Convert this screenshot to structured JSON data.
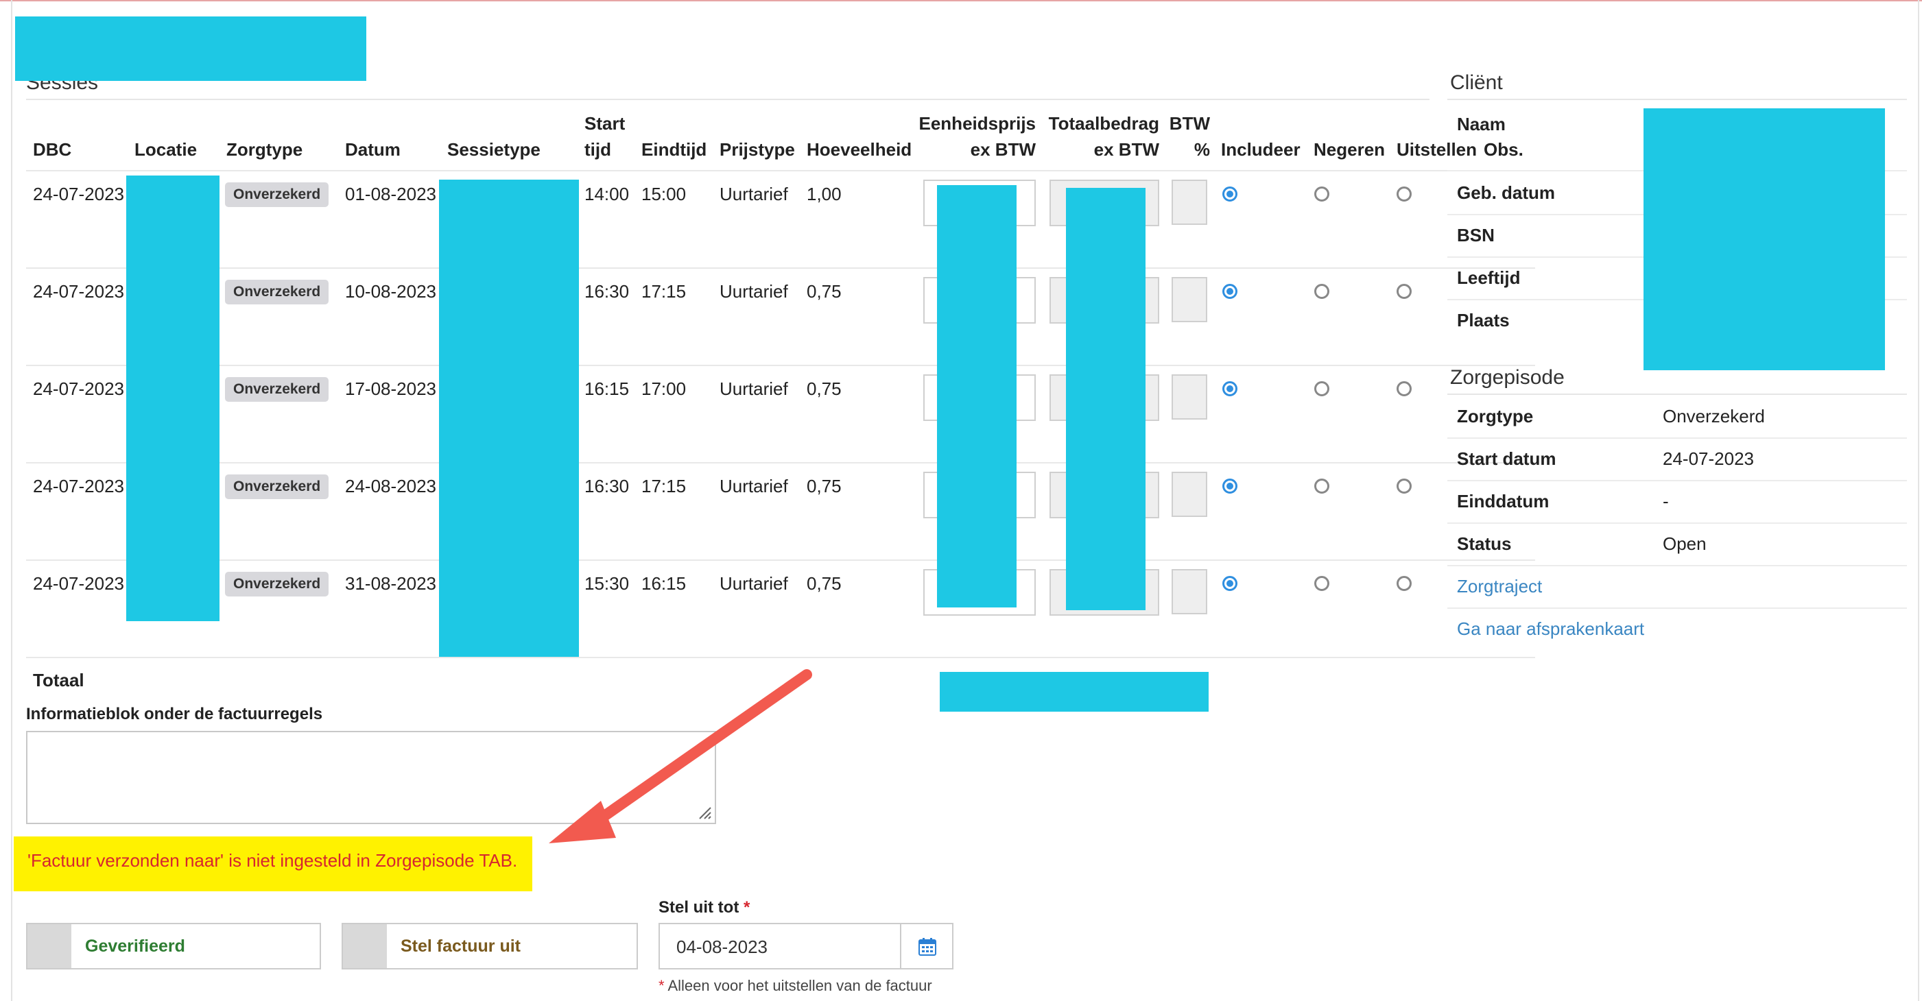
{
  "sessions": {
    "title": "Sessies",
    "columns": {
      "dbc": "DBC",
      "locatie": "Locatie",
      "zorgtype": "Zorgtype",
      "datum": "Datum",
      "sessietype": "Sessietype",
      "start_1": "Start",
      "start_2": "tijd",
      "eindtijd": "Eindtijd",
      "prijstype": "Prijstype",
      "hoeveelheid": "Hoeveelheid",
      "eenheidsprijs_1": "Eenheidsprijs",
      "eenheidsprijs_2": "ex BTW",
      "totaalbedrag_1": "Totaalbedrag",
      "totaalbedrag_2": "ex BTW",
      "btw_1": "BTW",
      "btw_2": "%",
      "includeer": "Includeer",
      "negeren": "Negeren",
      "uitstellen": "Uitstellen",
      "obs": "Obs."
    },
    "rows": [
      {
        "dbc": "24-07-2023",
        "zorgtype": "Onverzekerd",
        "datum": "01-08-2023",
        "start": "14:00",
        "eind": "15:00",
        "prijstype": "Uurtarief",
        "hoeveelheid": "1,00",
        "choice": "includeer"
      },
      {
        "dbc": "24-07-2023",
        "zorgtype": "Onverzekerd",
        "datum": "10-08-2023",
        "start": "16:30",
        "eind": "17:15",
        "prijstype": "Uurtarief",
        "hoeveelheid": "0,75",
        "choice": "includeer"
      },
      {
        "dbc": "24-07-2023",
        "zorgtype": "Onverzekerd",
        "datum": "17-08-2023",
        "start": "16:15",
        "eind": "17:00",
        "prijstype": "Uurtarief",
        "hoeveelheid": "0,75",
        "choice": "includeer"
      },
      {
        "dbc": "24-07-2023",
        "zorgtype": "Onverzekerd",
        "datum": "24-08-2023",
        "start": "16:30",
        "eind": "17:15",
        "prijstype": "Uurtarief",
        "hoeveelheid": "0,75",
        "choice": "includeer"
      },
      {
        "dbc": "24-07-2023",
        "zorgtype": "Onverzekerd",
        "datum": "31-08-2023",
        "start": "15:30",
        "eind": "16:15",
        "prijstype": "Uurtarief",
        "hoeveelheid": "0,75",
        "choice": "includeer"
      }
    ],
    "totaal_label": "Totaal"
  },
  "client": {
    "title": "Cliënt",
    "naam_label": "Naam",
    "geb_label": "Geb. datum",
    "bsn_label": "BSN",
    "leeftijd_label": "Leeftijd",
    "plaats_label": "Plaats"
  },
  "zorgepisode": {
    "title": "Zorgepisode",
    "zorgtype_label": "Zorgtype",
    "zorgtype_value": "Onverzekerd",
    "start_label": "Start datum",
    "start_value": "24-07-2023",
    "eind_label": "Einddatum",
    "eind_value": "-",
    "status_label": "Status",
    "status_value": "Open",
    "link_zorgtraject": "Zorgtraject",
    "link_afsprakenkaart": "Ga naar afsprakenkaart"
  },
  "form": {
    "info_label": "Informatieblok onder de factuurregels",
    "warning": "'Factuur verzonden naar' is niet ingesteld in Zorgepisode TAB.",
    "geverifieerd": "Geverifieerd",
    "stel_factuur_uit": "Stel factuur uit",
    "stel_uit_tot_label": "Stel uit tot",
    "required_mark": "*",
    "date_value": "04-08-2023",
    "hint": "Alleen voor het uitstellen van de factuur"
  },
  "colors": {
    "accent": "#2f8fe0",
    "link": "#3a86c2",
    "redaction": "#1ec8e4",
    "warning_bg": "#fff200",
    "warning_text": "#d6262f",
    "annotation_arrow": "#f25a4f",
    "verified_text": "#2e7d32",
    "postpone_text": "#7a5a1e"
  },
  "icons": {
    "date_picker": "calendar-icon",
    "resize": "resize-grip-icon",
    "annotation": "annotation-arrow"
  }
}
